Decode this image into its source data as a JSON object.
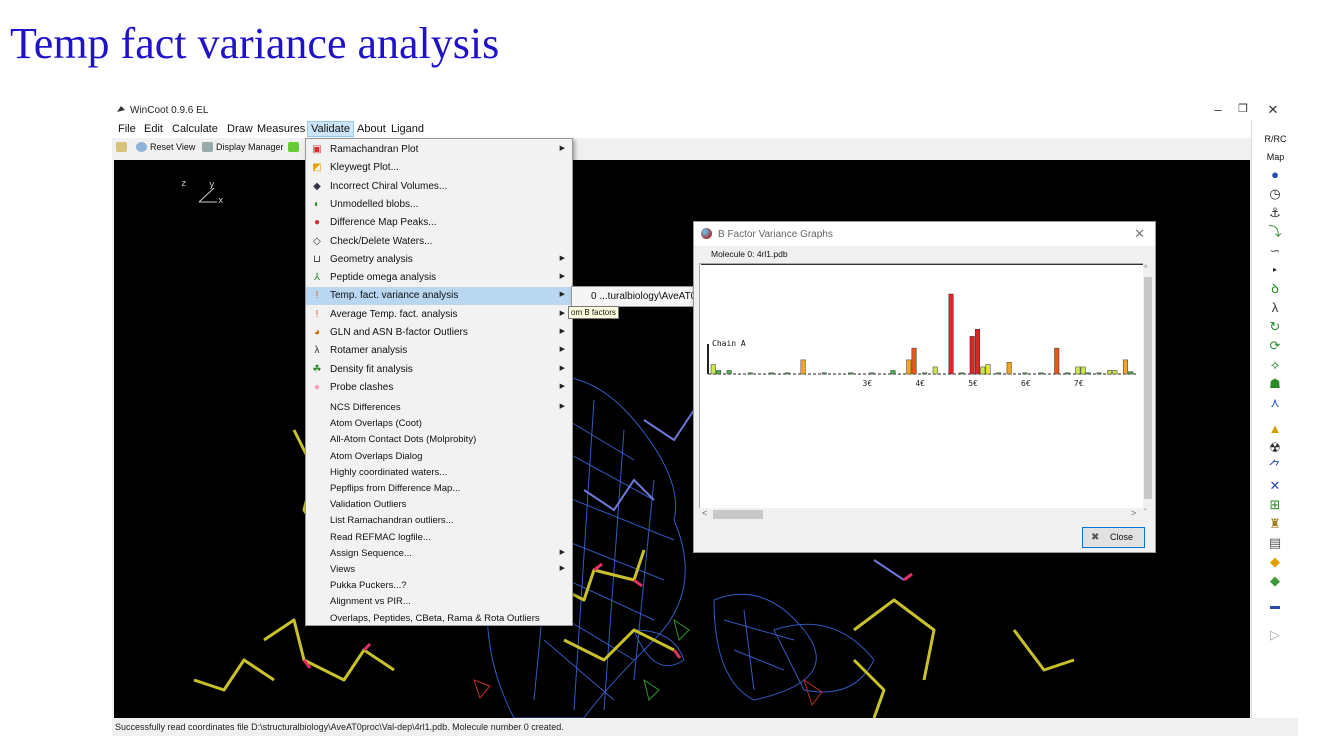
{
  "slide_title": "Temp fact variance analysis",
  "window": {
    "title": "WinCoot 0.9.6 EL",
    "controls": {
      "minimize": "–",
      "maximize": "❐",
      "close": "✕"
    }
  },
  "menubar": {
    "file": "File",
    "edit": "Edit",
    "calculate": "Calculate",
    "draw": "Draw",
    "measures": "Measures",
    "validate": "Validate",
    "about": "About",
    "ligand": "Ligand"
  },
  "toolbar": {
    "reset_view": "Reset View",
    "display_manager": "Display Manager"
  },
  "canvas": {
    "axis_z": "z",
    "axis_y": "y",
    "axis_x": "x"
  },
  "validate_menu": {
    "items": [
      {
        "label": "Ramachandran Plot",
        "icon": "ramachandran-icon",
        "submenu": true
      },
      {
        "label": "Kleywegt Plot...",
        "icon": "kleywegt-icon",
        "submenu": false
      },
      {
        "label": "Incorrect Chiral Volumes...",
        "icon": "chiral-icon",
        "submenu": false
      },
      {
        "label": "Unmodelled blobs...",
        "icon": "blob-icon",
        "submenu": false
      },
      {
        "label": "Difference Map Peaks...",
        "icon": "peaks-icon",
        "submenu": false
      },
      {
        "label": "Check/Delete Waters...",
        "icon": "water-drop-icon",
        "submenu": false
      },
      {
        "label": "Geometry analysis",
        "icon": "geometry-icon",
        "submenu": true
      },
      {
        "label": "Peptide omega analysis",
        "icon": "omega-icon",
        "submenu": true
      },
      {
        "label": "Temp. fact. variance analysis",
        "icon": "thermometer-icon",
        "submenu": true
      },
      {
        "label": "Average Temp. fact. analysis",
        "icon": "thermometer-icon",
        "submenu": true
      },
      {
        "label": "GLN and ASN B-factor Outliers",
        "icon": "gln-asn-icon",
        "submenu": true
      },
      {
        "label": "Rotamer analysis",
        "icon": "rotamer-icon",
        "submenu": true
      },
      {
        "label": "Density fit analysis",
        "icon": "density-fit-icon",
        "submenu": true
      },
      {
        "label": "Probe clashes",
        "icon": "probe-icon",
        "submenu": true
      }
    ],
    "plain_items": [
      {
        "label": "NCS Differences",
        "submenu": true
      },
      {
        "label": "Atom Overlaps (Coot)",
        "submenu": false
      },
      {
        "label": "All-Atom Contact Dots (Molprobity)",
        "submenu": false
      },
      {
        "label": "Atom Overlaps Dialog",
        "submenu": false
      },
      {
        "label": "Highly coordinated waters...",
        "submenu": false
      },
      {
        "label": "Pepflips from Difference Map...",
        "submenu": false
      },
      {
        "label": "Validation Outliers",
        "submenu": false
      },
      {
        "label": "List Ramachandran outliers...",
        "submenu": false
      },
      {
        "label": "Read REFMAC logfile...",
        "submenu": false
      },
      {
        "label": "Assign Sequence...",
        "submenu": true
      },
      {
        "label": "Views",
        "submenu": true
      },
      {
        "label": "Pukka Puckers...?",
        "submenu": false
      },
      {
        "label": "Alignment vs PIR...",
        "submenu": false
      },
      {
        "label": "Overlaps, Peptides, CBeta, Rama & Rota Outliers",
        "submenu": false
      }
    ],
    "highlighted_index": 8
  },
  "submenu": {
    "label": "0 ...turalbiology\\AveAT0proc\\Val-dep\\4rl1.pdb"
  },
  "tooltip": {
    "label": "om B factors"
  },
  "dialog": {
    "title": "B Factor Variance Graphs",
    "molecule_label": "Molecule 0: 4rl1.pdb",
    "close_label": "Close"
  },
  "chart_data": {
    "type": "bar",
    "title": "Chain A",
    "xtick_labels": [
      "3€",
      "4€",
      "5€",
      "6€",
      "7€"
    ],
    "xtick_positions": [
      30,
      40,
      50,
      60,
      70
    ],
    "x_range": [
      1,
      75
    ],
    "values": [
      {
        "x": 1,
        "v": 8,
        "color": "#c9e84a"
      },
      {
        "x": 2,
        "v": 3,
        "color": "#4caf50"
      },
      {
        "x": 4,
        "v": 3,
        "color": "#4caf50"
      },
      {
        "x": 8,
        "v": 1,
        "color": "#4caf50"
      },
      {
        "x": 12,
        "v": 1,
        "color": "#4caf50"
      },
      {
        "x": 15,
        "v": 1,
        "color": "#4caf50"
      },
      {
        "x": 18,
        "v": 12,
        "color": "#f2a623"
      },
      {
        "x": 22,
        "v": 1,
        "color": "#4caf50"
      },
      {
        "x": 27,
        "v": 1,
        "color": "#4caf50"
      },
      {
        "x": 31,
        "v": 1,
        "color": "#4caf50"
      },
      {
        "x": 35,
        "v": 3,
        "color": "#4caf50"
      },
      {
        "x": 38,
        "v": 12,
        "color": "#f2a623"
      },
      {
        "x": 39,
        "v": 22,
        "color": "#e8561c"
      },
      {
        "x": 41,
        "v": 1,
        "color": "#4caf50"
      },
      {
        "x": 43,
        "v": 6,
        "color": "#c9e84a"
      },
      {
        "x": 46,
        "v": 68,
        "color": "#e02424"
      },
      {
        "x": 48,
        "v": 1,
        "color": "#4caf50"
      },
      {
        "x": 50,
        "v": 32,
        "color": "#e02424"
      },
      {
        "x": 51,
        "v": 38,
        "color": "#e02424"
      },
      {
        "x": 52,
        "v": 6,
        "color": "#c9e84a"
      },
      {
        "x": 53,
        "v": 8,
        "color": "#e6e632"
      },
      {
        "x": 55,
        "v": 1,
        "color": "#4caf50"
      },
      {
        "x": 57,
        "v": 10,
        "color": "#f2a623"
      },
      {
        "x": 60,
        "v": 1,
        "color": "#4caf50"
      },
      {
        "x": 63,
        "v": 1,
        "color": "#4caf50"
      },
      {
        "x": 66,
        "v": 22,
        "color": "#e8561c"
      },
      {
        "x": 68,
        "v": 1,
        "color": "#4caf50"
      },
      {
        "x": 70,
        "v": 6,
        "color": "#c9e84a"
      },
      {
        "x": 71,
        "v": 6,
        "color": "#c9e84a"
      },
      {
        "x": 72,
        "v": 1,
        "color": "#4caf50"
      },
      {
        "x": 74,
        "v": 1,
        "color": "#4caf50"
      },
      {
        "x": 76,
        "v": 3,
        "color": "#c9e84a"
      },
      {
        "x": 77,
        "v": 3,
        "color": "#c9e84a"
      },
      {
        "x": 79,
        "v": 12,
        "color": "#f2a623"
      },
      {
        "x": 80,
        "v": 2,
        "color": "#4caf50"
      }
    ]
  },
  "right_toolbar": {
    "rrc_label": "R/RC",
    "map_label": "Map"
  },
  "status": "Successfully read coordinates file D:\\structuralbiology\\AveAT0proc\\Val-dep\\4rl1.pdb.  Molecule number 0 created."
}
